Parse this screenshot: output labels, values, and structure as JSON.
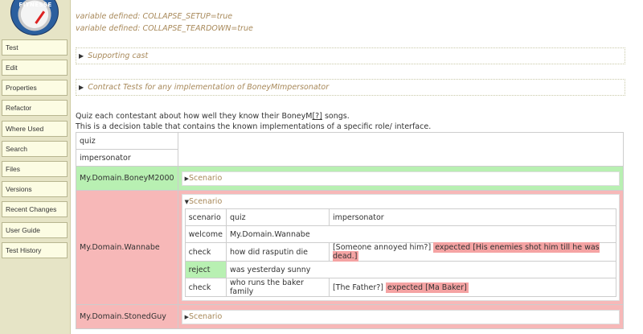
{
  "logo": {
    "text": "FITNESSE"
  },
  "sidebar": {
    "items": [
      {
        "label": "Test"
      },
      {
        "label": "Edit"
      },
      {
        "label": "Properties"
      },
      {
        "label": "Refactor"
      },
      {
        "label": "Where Used"
      },
      {
        "label": "Search"
      },
      {
        "label": "Files"
      },
      {
        "label": "Versions"
      },
      {
        "label": "Recent Changes"
      },
      {
        "label": "User Guide"
      },
      {
        "label": "Test History"
      }
    ]
  },
  "variables": [
    "variable defined: COLLAPSE_SETUP=true",
    "variable defined: COLLAPSE_TEARDOWN=true"
  ],
  "sections": [
    {
      "title": "Supporting cast"
    },
    {
      "title": "Contract Tests for any implementation of BoneyMImpersonator"
    }
  ],
  "intro": {
    "line1_pre": "Quiz each contestant about how well they know their BoneyM",
    "line1_link": "[?]",
    "line1_post": " songs.",
    "line2": "This is a decision table that contains the known implementations of a specific role/ interface."
  },
  "table": {
    "header": [
      "quiz",
      "impersonator"
    ],
    "rows": [
      {
        "name": "My.Domain.BoneyM2000",
        "status": "pass",
        "scenario": "Scenario"
      },
      {
        "name": "My.Domain.Wannabe",
        "status": "fail",
        "scenario": "Scenario",
        "inner": {
          "header": [
            "scenario",
            "quiz",
            "impersonator"
          ],
          "welcome": [
            "welcome",
            "My.Domain.Wannabe"
          ],
          "check1": {
            "c1": "check",
            "c2": "how did rasputin die",
            "actual": "[Someone annoyed him?]",
            "expected": "expected [His enemies shot him till he was dead.]"
          },
          "reject": [
            "reject",
            "was yesterday sunny"
          ],
          "check2": {
            "c1": "check",
            "c2": "who runs the baker family",
            "actual": "[The Father?]",
            "expected": "expected [Ma Baker]"
          }
        }
      },
      {
        "name": "My.Domain.StonedGuy",
        "status": "fail",
        "scenario": "Scenario"
      }
    ]
  },
  "colors": {
    "pass": "#b8f0b2",
    "fail": "#f7b8b8",
    "expected": "#f5a3a3",
    "sidebar": "#e6e4c6",
    "accent_text": "#a8895a"
  }
}
